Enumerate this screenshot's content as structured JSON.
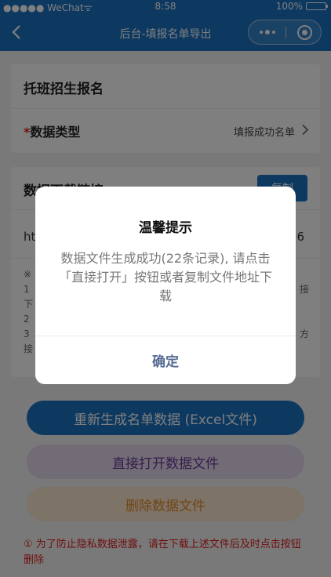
{
  "status_bar": {
    "carrier": "●●●●● WeChat",
    "wifi_glyph": "ᯤ",
    "time": "8:58",
    "battery": "100%",
    "battery_level": 1.0
  },
  "nav": {
    "title": "后台-填报名单导出"
  },
  "card_enroll": {
    "title": "托班招生报名",
    "field_required_mark": "*",
    "field_label": "数据类型",
    "field_value": "填报成功名单"
  },
  "card_download": {
    "title": "数据下载链接",
    "copy_label": "复制",
    "url_text": "ht",
    "url_tail": "6",
    "tips": [
      "※",
      "1",
      "下",
      "2",
      "3",
      "接"
    ],
    "tips_right": [
      "接",
      "方"
    ]
  },
  "buttons": {
    "regenerate": "重新生成名单数据 (Excel文件)",
    "open": "直接打开数据文件",
    "delete": "删除数据文件"
  },
  "warning": "① 为了防止隐私数据泄露，请在下载上述文件后及时点击按钮删除",
  "dialog": {
    "title": "温馨提示",
    "message": "数据文件生成成功(22条记录), 请点击「直接打开」按钮或者复制文件地址下载",
    "confirm": "确定"
  },
  "colors": {
    "primary": "#1a73c2",
    "danger": "#e02020",
    "dialog_confirm": "#576b95"
  }
}
